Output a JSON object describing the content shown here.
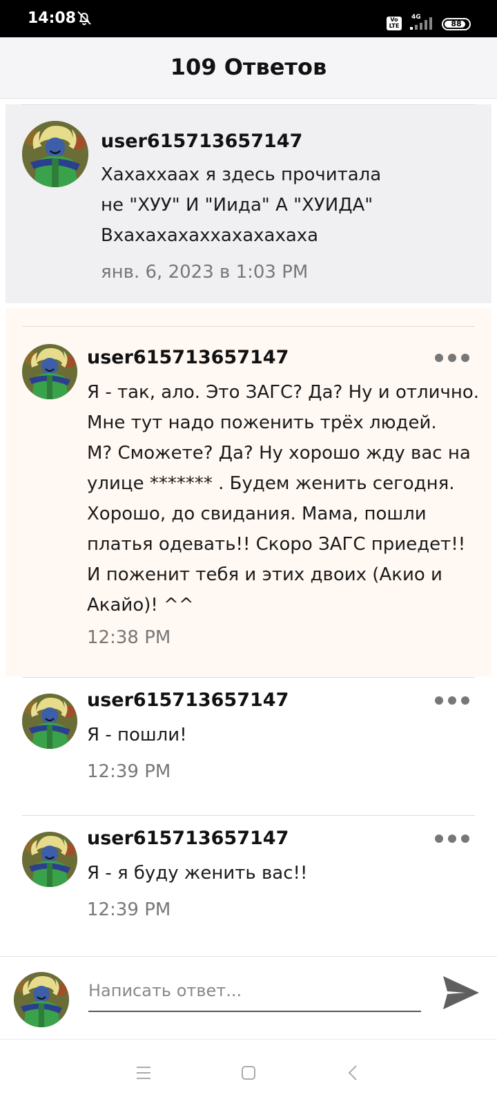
{
  "status_bar": {
    "time": "14:08",
    "volte_label": "Vo\nLTE",
    "network": "4G",
    "battery": "88",
    "battery_level": 0.88
  },
  "header": {
    "title": "109 Ответов"
  },
  "parent_comment": {
    "username": "user615713657147",
    "text": "Хахаххаах я здесь прочитала\nне \"ХУУ\" И \"Иида\" А \"ХУИДА\"\nВхахахахаххахахахаха",
    "timestamp": "янв. 6, 2023 в 1:03 PM"
  },
  "replies": [
    {
      "username": "user615713657147",
      "text": "Я - так, ало. Это ЗАГС? Да? Ну и отлично.\nМне тут надо поженить трёх людей.\nМ? Сможете? Да? Ну хорошо жду вас на\nулице ******* . Будем женить сегодня.\nХорошо, до свидания. Мама, пошли\nплатья одевать!! Скоро ЗАГС приедет!!\nИ поженит тебя и этих двоих (Акио и\nАкайо)! ^^",
      "timestamp": "12:38 PM"
    },
    {
      "username": "user615713657147",
      "text": "Я - пошли!",
      "timestamp": "12:39 PM"
    },
    {
      "username": "user615713657147",
      "text": "Я - я буду женить вас!!",
      "timestamp": "12:39 PM"
    }
  ],
  "input": {
    "placeholder": "Написать ответ..."
  },
  "icons": {
    "bell": "bell-off-icon",
    "more": "more-horizontal-icon",
    "send": "send-icon",
    "nav_menu": "menu-icon",
    "nav_home": "square-icon",
    "nav_back": "back-icon"
  },
  "colors": {
    "header_bg": "#f5f5f7",
    "highlight_bg": "#fff8f3",
    "parent_bg": "#f0f0f3",
    "muted_text": "#777777"
  }
}
